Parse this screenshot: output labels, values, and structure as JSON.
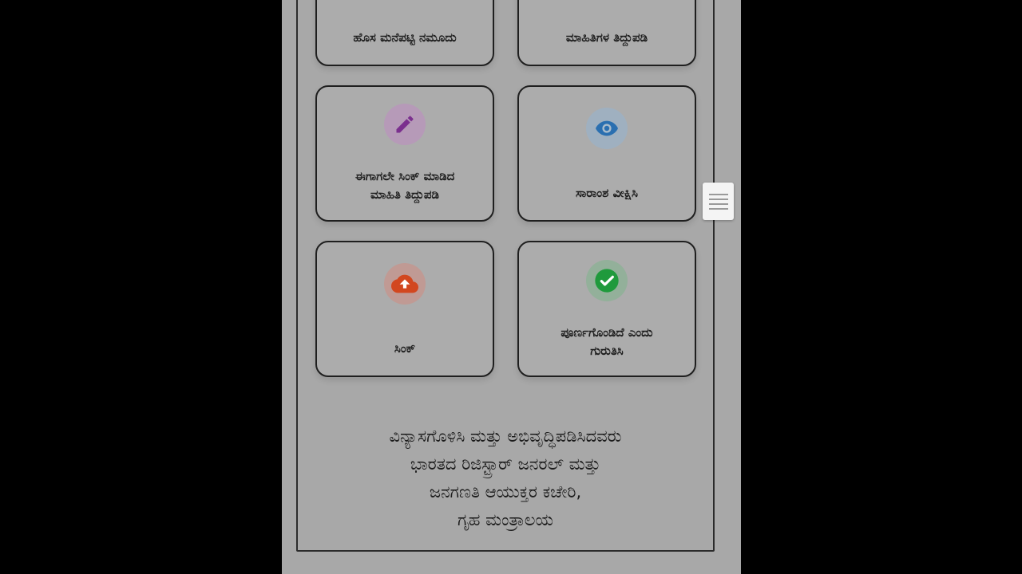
{
  "cards": [
    {
      "label": "ಹೊಸ ಮನೆಪಟ್ಟಿ ನಮೂದು",
      "icon": "",
      "icon_color": ""
    },
    {
      "label": "ಮಾಹಿತಿಗಳ ತಿದ್ದುಪಡಿ",
      "icon": "",
      "icon_color": ""
    },
    {
      "label": "ಈಗಾಗಲೇ ಸಿಂಕ್ ಮಾಡಿದ\nಮಾಹಿತಿ ತಿದ್ದುಪಡಿ",
      "icon": "pencil-icon",
      "icon_color": "#7b2f8e"
    },
    {
      "label": "ಸಾರಾಂಶ ವೀಕ್ಷಿಸಿ",
      "icon": "eye-icon",
      "icon_color": "#2a6fb0"
    },
    {
      "label": "ಸಿಂಕ್",
      "icon": "cloud-upload-icon",
      "icon_color": "#d2471f"
    },
    {
      "label": "ಪೂರ್ಣಗೊಂಡಿದೆ ಎಂದು\nಗುರುತಿಸಿ",
      "icon": "check-circle-icon",
      "icon_color": "#1f9a3c"
    }
  ],
  "footer": {
    "line1": "ವಿನ್ಯಾಸಗೊಳಿಸಿ ಮತ್ತು ಅಭಿವೃದ್ಧಿಪಡಿಸಿದವರು",
    "line2": "ಭಾರತದ ರಿಜಿಸ್ಟ್ರಾರ್ ಜನರಲ್ ಮತ್ತು",
    "line3": "ಜನಗಣತಿ ಆಯುಕ್ತರ ಕಚೇರಿ,",
    "line4": "ಗೃಹ ಮಂತ್ರಾಲಯ"
  },
  "handle": {
    "icon": "menu-lines-icon"
  }
}
